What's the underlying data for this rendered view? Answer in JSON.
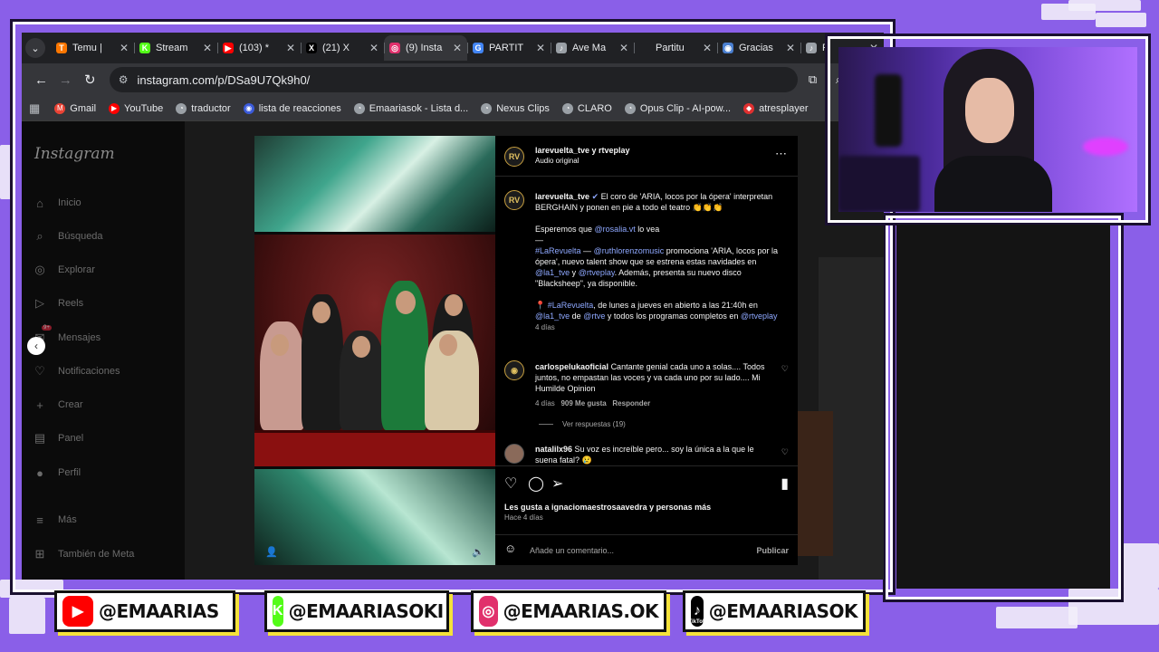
{
  "browser": {
    "tabs": [
      {
        "label": "Temu |",
        "favicon_color": "#fb7701",
        "favicon": "T",
        "active": false
      },
      {
        "label": "Stream",
        "favicon_color": "#53fc18",
        "favicon": "K",
        "active": false
      },
      {
        "label": "(103) *",
        "favicon_color": "#ff0000",
        "favicon": "▶",
        "active": false
      },
      {
        "label": "(21) X",
        "favicon_color": "#000000",
        "favicon": "X",
        "active": false
      },
      {
        "label": "(9) Insta",
        "favicon_color": "#e1306c",
        "favicon": "◎",
        "active": true
      },
      {
        "label": "PARTIT",
        "favicon_color": "#4285f4",
        "favicon": "G",
        "active": false
      },
      {
        "label": "Ave Ma",
        "favicon_color": "#9aa0a6",
        "favicon": "♪",
        "active": false
      },
      {
        "label": "Partitu",
        "favicon_color": "#202124",
        "favicon": "",
        "active": false
      },
      {
        "label": "Gracias",
        "favicon_color": "#4a7fd0",
        "favicon": "◉",
        "active": false
      },
      {
        "label": "P",
        "favicon_color": "#9aa0a6",
        "favicon": "♪",
        "active": false
      }
    ],
    "url": "instagram.com/p/DSa9U7Qk9h0/",
    "bookmarks": [
      {
        "label": "Gmail",
        "color": "#ea4335",
        "icon": "M"
      },
      {
        "label": "YouTube",
        "color": "#ff0000",
        "icon": "▶"
      },
      {
        "label": "traductor",
        "color": "#9aa0a6",
        "icon": "◔"
      },
      {
        "label": "lista de reacciones",
        "color": "#3b5bdb",
        "icon": "◉"
      },
      {
        "label": "Emaariasok - Lista d...",
        "color": "#9aa0a6",
        "icon": "◔"
      },
      {
        "label": "Nexus Clips",
        "color": "#9aa0a6",
        "icon": "◔"
      },
      {
        "label": "CLARO",
        "color": "#9aa0a6",
        "icon": "◔"
      },
      {
        "label": "Opus Clip - AI-pow...",
        "color": "#9aa0a6",
        "icon": "◔"
      },
      {
        "label": "atresplayer",
        "color": "#e03030",
        "icon": "◆"
      }
    ]
  },
  "instagram": {
    "logo": "Instagram",
    "nav": [
      {
        "label": "Inicio",
        "icon": "⌂",
        "name": "home-icon"
      },
      {
        "label": "Búsqueda",
        "icon": "⌕",
        "name": "search-icon"
      },
      {
        "label": "Explorar",
        "icon": "◎",
        "name": "explore-icon"
      },
      {
        "label": "Reels",
        "icon": "▷",
        "name": "reels-icon"
      },
      {
        "label": "Mensajes",
        "icon": "✉",
        "name": "messages-icon"
      },
      {
        "label": "Notificaciones",
        "icon": "♡",
        "name": "heart-icon"
      },
      {
        "label": "Crear",
        "icon": "+",
        "name": "create-icon"
      },
      {
        "label": "Panel",
        "icon": "▤",
        "name": "dashboard-icon"
      },
      {
        "label": "Perfil",
        "icon": "●",
        "name": "profile-icon"
      },
      {
        "label": "Más",
        "icon": "≡",
        "name": "menu-icon"
      },
      {
        "label": "También de Meta",
        "icon": "⊞",
        "name": "meta-icon"
      }
    ],
    "messages_badge": "9+",
    "post": {
      "header_user": "larevuelta_tve y rtveplay",
      "header_audio": "Audio original",
      "avatar": "RV",
      "caption_user": "larevuelta_tve",
      "caption_l1": "El coro de 'ARIA, locos por la ópera' interpretan",
      "caption_l2": "BERGHAIN y ponen en pie a todo el teatro 👏👏👏",
      "caption_l3_pre": "Esperemos que ",
      "caption_l3_mention": "@rosalia.vt",
      "caption_l3_post": " lo vea",
      "divider": "—",
      "p2_l1_tag": "#LaRevuelta",
      "p2_l1_mid": " — ",
      "p2_l1_mention": "@ruthlorenzomusic",
      "p2_l1_post": " promociona 'ARIA, locos por la",
      "p2_l2": "ópera', nuevo talent show que se estrena estas navidades en",
      "p2_l3_m1": "@la1_tve",
      "p2_l3_y": " y ",
      "p2_l3_m2": "@rtveplay",
      "p2_l3_post": ". Además, presenta su nuevo disco",
      "p2_l4": "\"Blacksheep\", ya disponible.",
      "p3_l1_pre": "📍 ",
      "p3_l1_tag": "#LaRevuelta",
      "p3_l1_post": ", de lunes a jueves en abierto a las 21:40h en",
      "p3_l2_m1": "@la1_tve",
      "p3_l2_de": " de ",
      "p3_l2_m2": "@rtve",
      "p3_l2_mid": " y todos los programas completos en ",
      "p3_l2_m3": "@rtveplay",
      "caption_time": "4 días",
      "comments": [
        {
          "user": "carlospelukaoficial",
          "l1": "Cantante genial cada uno a solas.... Todos",
          "l2": "juntos, no empastan las voces y va cada uno por su lado.... Mi",
          "l3": "Humilde Opinion",
          "time": "4 días",
          "likes": "909 Me gusta",
          "reply": "Responder",
          "view_replies": "Ver respuestas (19)"
        },
        {
          "user": "natalilx96",
          "l1": "Su voz es increíble pero... soy la única a la que le",
          "l2": "suena fatal? 😢"
        }
      ],
      "likes_text": "Les gusta a ignaciomaestrosaavedra y personas más",
      "post_time": "Hace 4 días",
      "comment_placeholder": "Añade un comentario...",
      "publish": "Publicar"
    }
  },
  "socials": [
    {
      "handle": "@EMAARIAS",
      "platform": "youtube",
      "icon": "▶",
      "color": "#ff0000"
    },
    {
      "handle": "@EMAARIASOKI",
      "platform": "kick",
      "icon": "K",
      "color": "#53fc18"
    },
    {
      "handle": "@EMAARIAS.OK",
      "platform": "instagram",
      "icon": "◎",
      "color": "#e1306c"
    },
    {
      "handle": "@EMAARIASOK",
      "platform": "tiktok",
      "icon": "♪",
      "color": "#000000",
      "sub": "TikTok"
    }
  ]
}
